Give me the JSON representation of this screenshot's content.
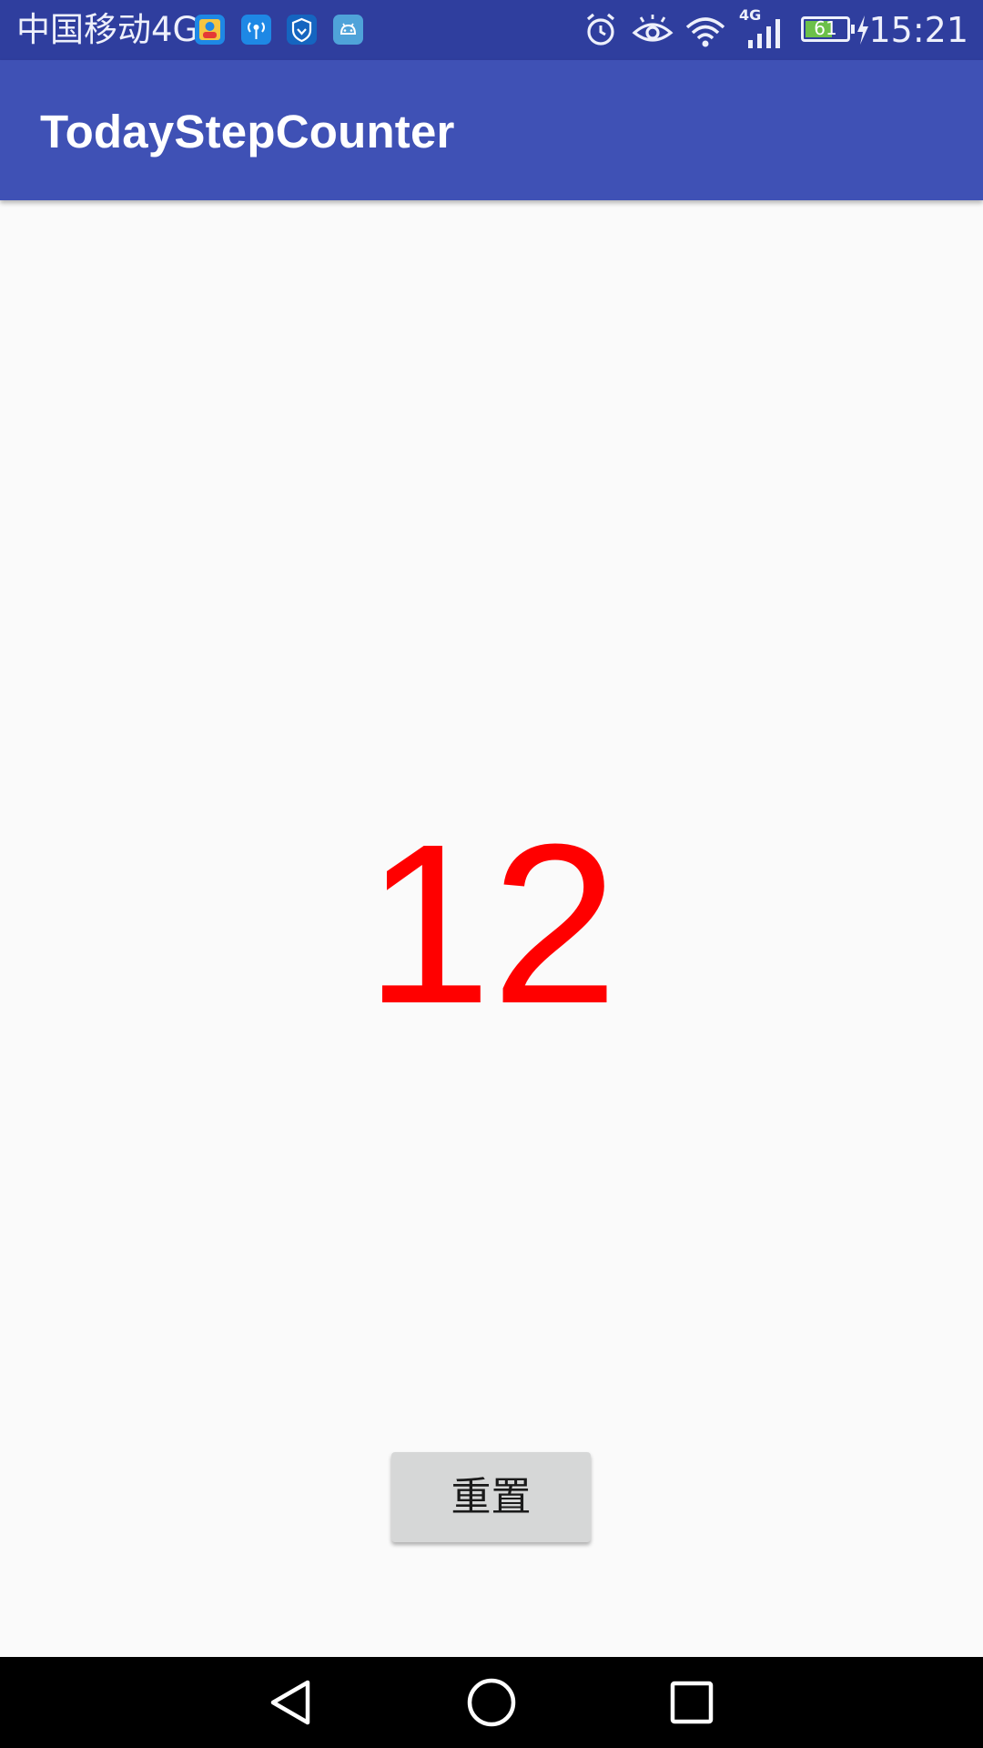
{
  "status_bar": {
    "carrier": "中国移动4G",
    "network_badge": "4G",
    "battery_level": "61",
    "time": "15:21",
    "notification_icons": [
      "contacts-app-icon",
      "hotspot-app-icon",
      "security-shield-app-icon",
      "android-app-icon"
    ],
    "system_icons": [
      "alarm-icon",
      "eye-icon",
      "wifi-icon",
      "cellular-signal-icon",
      "battery-icon",
      "charging-icon"
    ]
  },
  "app_bar": {
    "title": "TodayStepCounter"
  },
  "main": {
    "step_count": "12",
    "reset_label": "重置"
  },
  "nav_bar": {
    "icons": [
      "back-icon",
      "home-icon",
      "recents-icon"
    ]
  },
  "colors": {
    "status_bar": "#2f3e9e",
    "app_bar": "#3f51b5",
    "step_count": "#ff0000",
    "button": "#d6d7d7",
    "background": "#fafafa"
  }
}
